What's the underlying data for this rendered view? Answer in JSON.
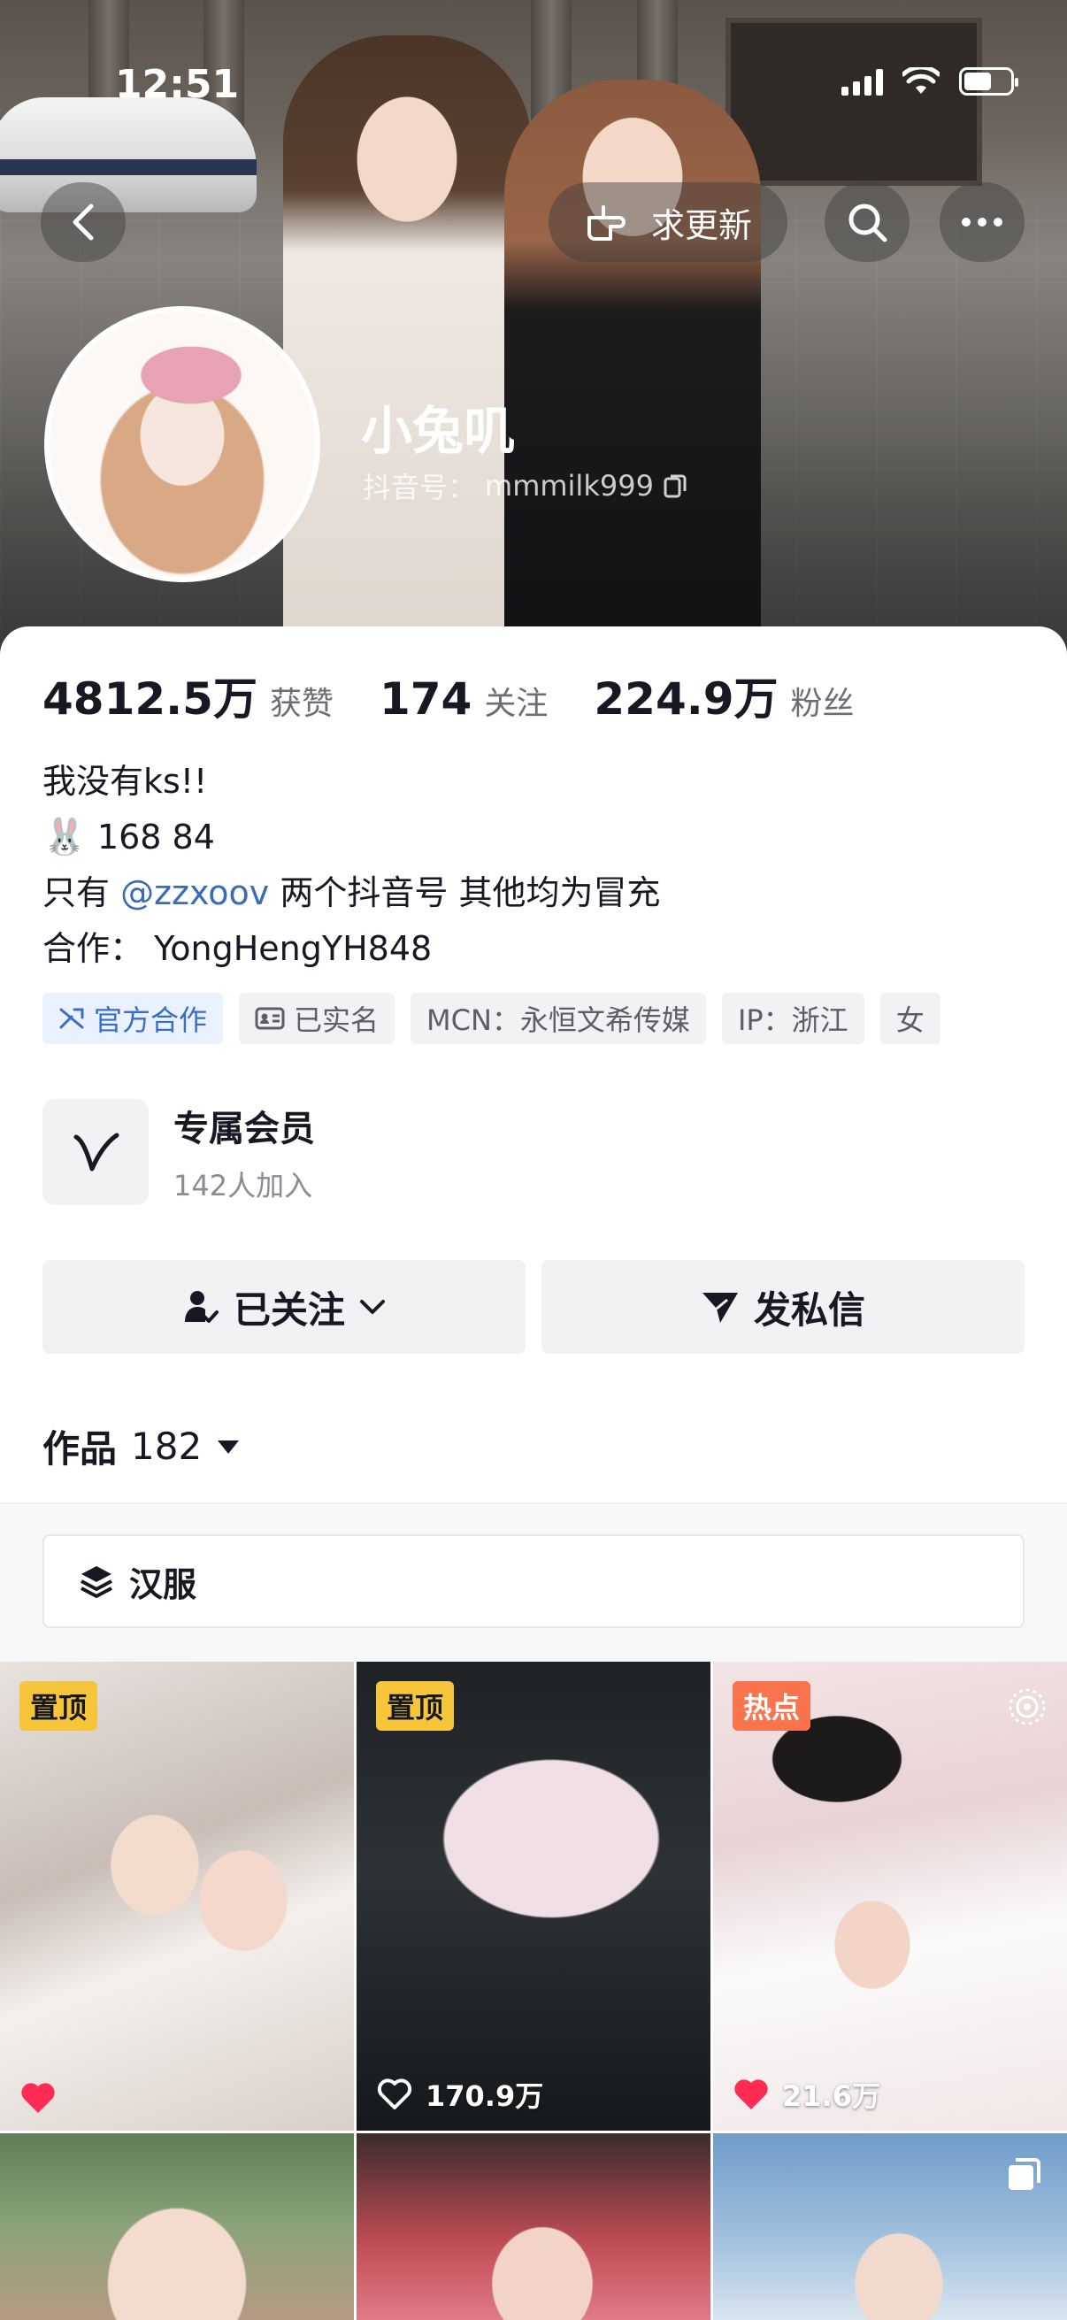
{
  "status_bar": {
    "time": "12:51"
  },
  "header": {
    "update_label": "求更新",
    "name": "小兔叽",
    "douyin_id_label": "抖音号：",
    "douyin_id": "mmmilk999"
  },
  "stats": [
    {
      "num": "4812.5万",
      "label": "获赞"
    },
    {
      "num": "174",
      "label": "关注"
    },
    {
      "num": "224.9万",
      "label": "粉丝"
    }
  ],
  "bio": {
    "line1": "我没有ks!!",
    "line2": "168 84",
    "line3_prefix": "只有 ",
    "mention": "@zzxoov",
    "line3_suffix": " 两个抖音号 其他均为冒充",
    "line4": "合作：  YongHengYH848"
  },
  "tags": [
    {
      "label": "官方合作",
      "icon": "official-cooperation-icon"
    },
    {
      "label": "已实名",
      "icon": "id-card-icon"
    },
    {
      "label": "MCN：永恒文希传媒"
    },
    {
      "label": "IP：浙江"
    },
    {
      "label": "女"
    }
  ],
  "member": {
    "title": "专属会员",
    "subtitle": "142人加入"
  },
  "actions": {
    "follow": "已关注",
    "message": "发私信"
  },
  "works": {
    "label": "作品",
    "count": "182"
  },
  "collection": {
    "label": "汉服"
  },
  "videos": [
    {
      "badge": "置顶",
      "badge_type": "pin",
      "likes": ""
    },
    {
      "badge": "置顶",
      "badge_type": "pin",
      "likes": "170.9万"
    },
    {
      "badge": "热点",
      "badge_type": "hot",
      "likes": "21.6万"
    },
    {
      "badge": "",
      "likes": ""
    },
    {
      "badge": "",
      "likes": ""
    },
    {
      "badge": "",
      "likes": ""
    }
  ],
  "colors": {
    "accent_link": "#3b6ab6",
    "pin_badge": "#f7c53a",
    "hot_badge": "#f8744c",
    "like_red": "#fe2c55"
  }
}
